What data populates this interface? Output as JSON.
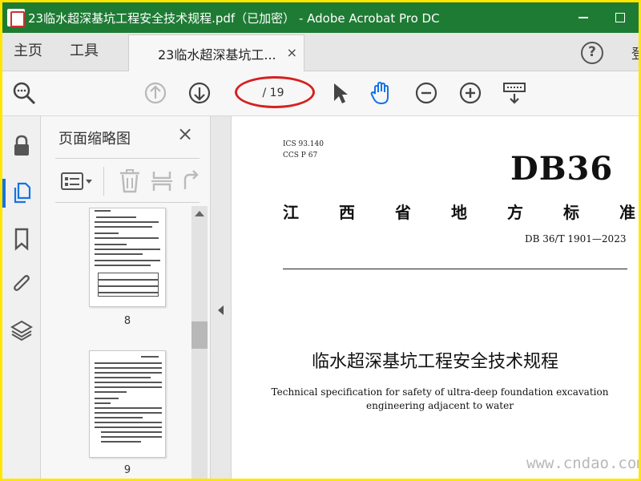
{
  "window": {
    "title": "23临水超深基坑工程安全技术规程.pdf（已加密） - Adobe Acrobat Pro DC",
    "minimize_icon": "minimize-icon",
    "maximize_icon": "maximize-icon"
  },
  "tabs": {
    "home": "主页",
    "tools": "工具",
    "document": "23临水超深基坑工...",
    "close_glyph": "×",
    "help_glyph": "?",
    "signin": "登"
  },
  "toolbar": {
    "page_indicator": "/ 19",
    "icons": [
      "search-zoom-icon",
      "page-up-icon",
      "page-down-icon",
      "select-arrow-icon",
      "hand-tool-icon",
      "zoom-out-icon",
      "zoom-in-icon",
      "keyboard-icon"
    ]
  },
  "thumbnails": {
    "title": "页面缩略图",
    "close_glyph": "×",
    "pages": [
      {
        "number": "8"
      },
      {
        "number": "9"
      }
    ]
  },
  "document": {
    "ics": "ICS  93.140",
    "ccs": "CCS  P 67",
    "standard_mark": "DB36",
    "province_chars": [
      "江",
      "西",
      "省",
      "地",
      "方",
      "标",
      "准"
    ],
    "code": "DB 36/T  1901—2023",
    "title_cn": "临水超深基坑工程安全技术规程",
    "title_en": "Technical specification for safety of ultra-deep foundation excavation engineering adjacent to water"
  },
  "watermark": "www.cndao.com",
  "colors": {
    "title_bar": "#1e7b34",
    "accent_blue": "#1473e6",
    "annotation_red": "#d62020",
    "border_yellow": "#ffe600"
  }
}
